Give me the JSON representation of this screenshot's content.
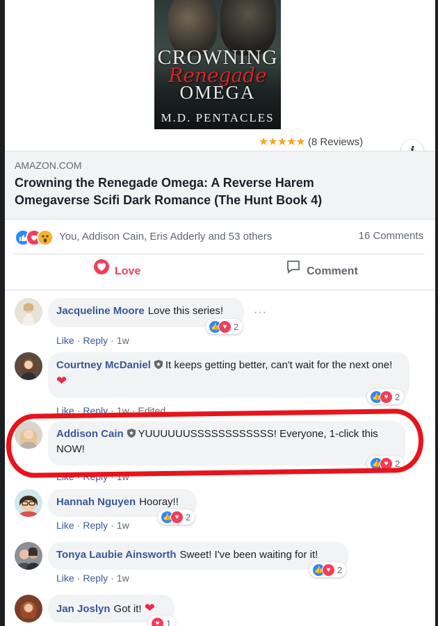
{
  "book": {
    "title_line1": "CROWNING",
    "title_line2": "Renegade",
    "title_line3": "OMEGA",
    "author": "M.D. PENTACLES",
    "reviews_text": "(8 Reviews)",
    "stars": "★★★★★",
    "info_icon": "info-icon"
  },
  "link": {
    "domain": "AMAZON.COM",
    "title": "Crowning the Renegade Omega: A Reverse Harem Omegaverse Scifi Dark Romance (The Hunt Book 4)"
  },
  "reactions_summary": {
    "icons": [
      "like",
      "love",
      "wow"
    ],
    "text": "You, Addison Cain, Eris Adderly and 53 others",
    "comments": "16 Comments"
  },
  "actions": {
    "love": "Love",
    "comment": "Comment"
  },
  "comments": [
    {
      "name": "Jacqueline Moore",
      "text": "Love this series!",
      "like": "Like",
      "reply": "Reply",
      "time": "1w",
      "reactions": "2"
    },
    {
      "name": "Courtney McDaniel",
      "text": "It keeps getting better, can't wait for the next one!",
      "like": "Like",
      "reply": "Reply",
      "time": "1w",
      "edited": "Edited",
      "reactions": "2"
    },
    {
      "name": "Addison Cain",
      "text": "YUUUUUUSSSSSSSSSSSS! Everyone, 1-click this NOW!",
      "like": "Like",
      "reply": "Reply",
      "time": "1w",
      "reactions": "2"
    },
    {
      "name": "Hannah Nguyen",
      "text": "Hooray!!",
      "like": "Like",
      "reply": "Reply",
      "time": "1w",
      "reactions": "2"
    },
    {
      "name": "Tonya Laubie Ainsworth",
      "text": "Sweet! I've been waiting for it!",
      "like": "Like",
      "reply": "Reply",
      "time": "1w",
      "reactions": "2"
    },
    {
      "name": "Jan Joslyn",
      "text": "Got it!",
      "reactions": "1"
    }
  ],
  "colors": {
    "link_blue": "#385898",
    "love_red": "#f33e58",
    "like_blue": "#2d88ff",
    "annotation_red": "#e8141b"
  }
}
